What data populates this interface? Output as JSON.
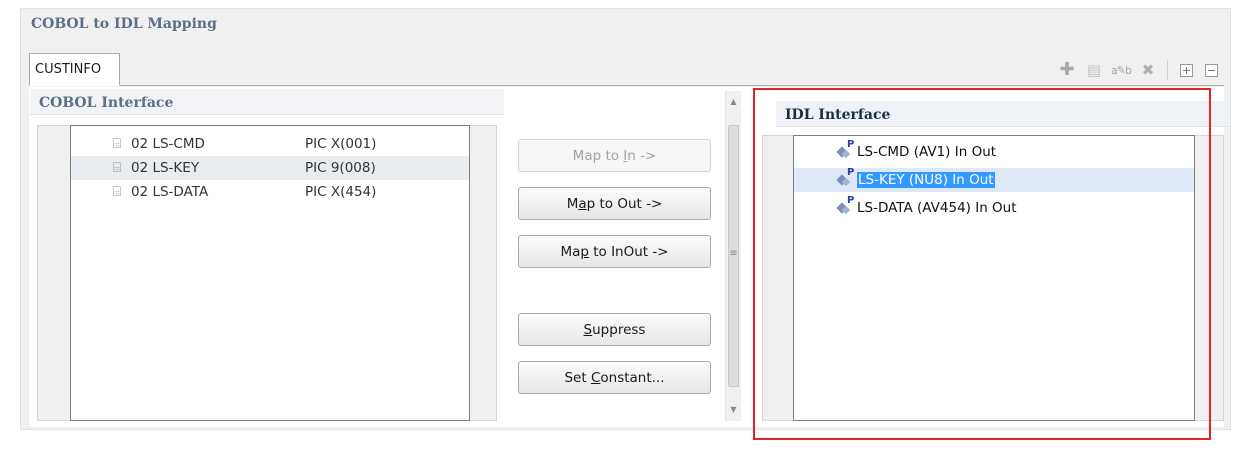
{
  "window": {
    "title": "COBOL to IDL Mapping"
  },
  "tab": {
    "label": "CUSTINFO"
  },
  "toolbar": {
    "icons": [
      "add-icon",
      "copy-document-icon",
      "rename-icon",
      "delete-icon",
      "expand-all-icon",
      "collapse-all-icon"
    ],
    "expand_glyph": "+",
    "collapse_glyph": "−"
  },
  "cobol": {
    "header": "COBOL Interface",
    "items": [
      {
        "name": "02 LS-CMD",
        "pic": "PIC  X(001)",
        "selected": false
      },
      {
        "name": "02 LS-KEY",
        "pic": "PIC  9(008)",
        "selected": true
      },
      {
        "name": "02 LS-DATA",
        "pic": "PIC  X(454)",
        "selected": false
      }
    ]
  },
  "buttons": {
    "map_in": {
      "pre": "Map to ",
      "u": "I",
      "post": "n ->",
      "enabled": false
    },
    "map_out": {
      "pre": "M",
      "u": "a",
      "post": "p to Out ->",
      "enabled": true
    },
    "map_inout": {
      "pre": "Ma",
      "u": "p",
      "post": " to InOut ->",
      "enabled": true
    },
    "suppress": {
      "pre": "",
      "u": "S",
      "post": "uppress",
      "enabled": true
    },
    "set_constant": {
      "pre": "Set ",
      "u": "C",
      "post": "onstant...",
      "enabled": true
    }
  },
  "idl": {
    "header": "IDL Interface",
    "items": [
      {
        "label": "LS-CMD  (AV1)  In Out",
        "selected": false
      },
      {
        "label": "LS-KEY  (NU8)  In Out",
        "selected": true
      },
      {
        "label": "LS-DATA  (AV454)  In Out",
        "selected": false
      }
    ]
  },
  "colors": {
    "highlight_box": "#e0242a",
    "selection": "#3399ff",
    "header_text": "#5c6f86"
  }
}
